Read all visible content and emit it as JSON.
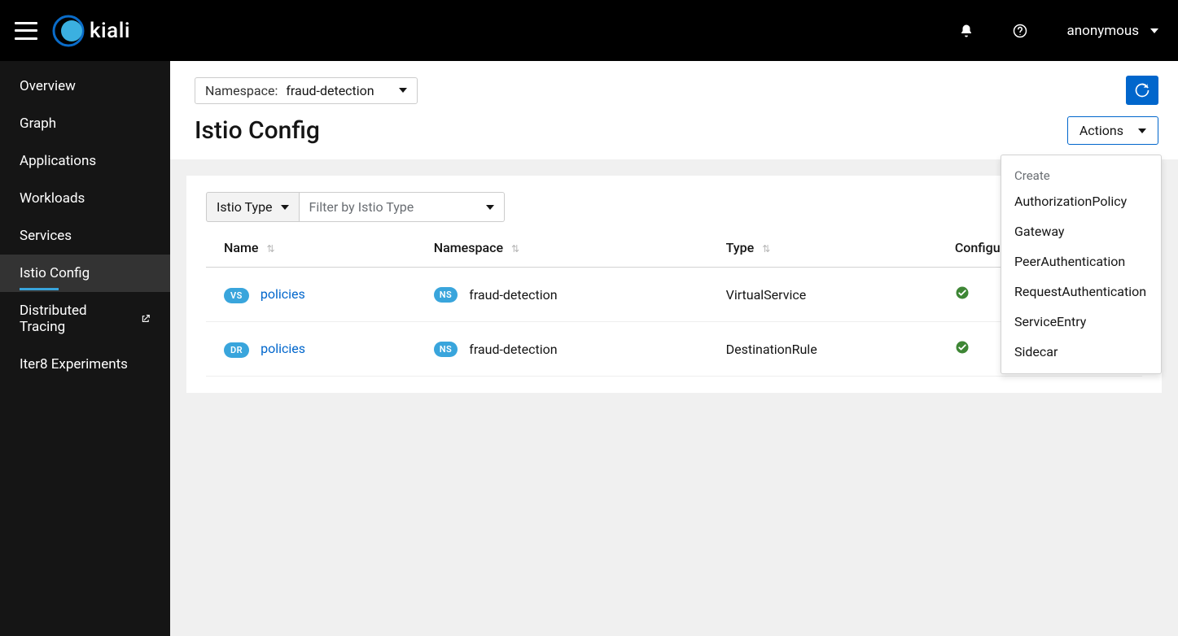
{
  "brand": "kiali",
  "user": "anonymous",
  "sidebar": {
    "items": [
      {
        "label": "Overview",
        "external": false
      },
      {
        "label": "Graph",
        "external": false
      },
      {
        "label": "Applications",
        "external": false
      },
      {
        "label": "Workloads",
        "external": false
      },
      {
        "label": "Services",
        "external": false
      },
      {
        "label": "Istio Config",
        "external": false
      },
      {
        "label": "Distributed Tracing",
        "external": true
      },
      {
        "label": "Iter8 Experiments",
        "external": false
      }
    ],
    "active_index": 5
  },
  "namespace": {
    "label": "Namespace:",
    "value": "fraud-detection"
  },
  "page_title": "Istio Config",
  "actions": {
    "button_label": "Actions",
    "section_label": "Create",
    "items": [
      "AuthorizationPolicy",
      "Gateway",
      "PeerAuthentication",
      "RequestAuthentication",
      "ServiceEntry",
      "Sidecar"
    ]
  },
  "filter": {
    "label": "Istio Type",
    "placeholder": "Filter by Istio Type"
  },
  "table": {
    "columns": {
      "name": "Name",
      "namespace": "Namespace",
      "type": "Type",
      "configuration": "Configuration"
    },
    "rows": [
      {
        "badge": "VS",
        "name": "policies",
        "ns_badge": "NS",
        "namespace": "fraud-detection",
        "type": "VirtualService",
        "config_ok": true
      },
      {
        "badge": "DR",
        "name": "policies",
        "ns_badge": "NS",
        "namespace": "fraud-detection",
        "type": "DestinationRule",
        "config_ok": true
      }
    ]
  }
}
